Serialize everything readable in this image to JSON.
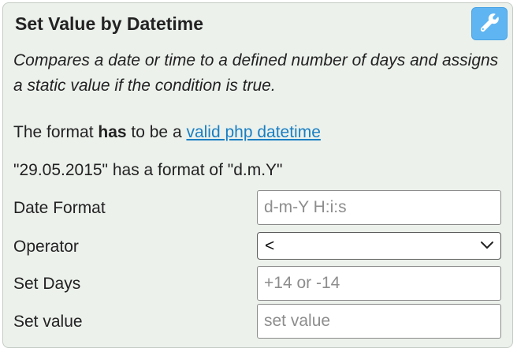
{
  "title": "Set Value by Datetime",
  "settings_icon": "wrench-icon",
  "description": "Compares a date or time to a defined number of days and assigns a static value if the condition is true.",
  "format_note": {
    "prefix": "The format ",
    "emphasis": "has",
    "middle": " to be a ",
    "link": "valid php datetime"
  },
  "example": "\"29.05.2015\" has a format of \"d.m.Y\"",
  "fields": {
    "date_format": {
      "label": "Date Format",
      "placeholder": "d-m-Y H:i:s",
      "value": ""
    },
    "operator": {
      "label": "Operator",
      "value": "<"
    },
    "set_days": {
      "label": "Set Days",
      "placeholder": "+14 or -14",
      "value": ""
    },
    "set_value": {
      "label": "Set value",
      "placeholder": "set value",
      "value": ""
    }
  },
  "colors": {
    "card_bg": "#ecf1ec",
    "accent": "#5fb5f2",
    "link": "#1a7fc2"
  }
}
